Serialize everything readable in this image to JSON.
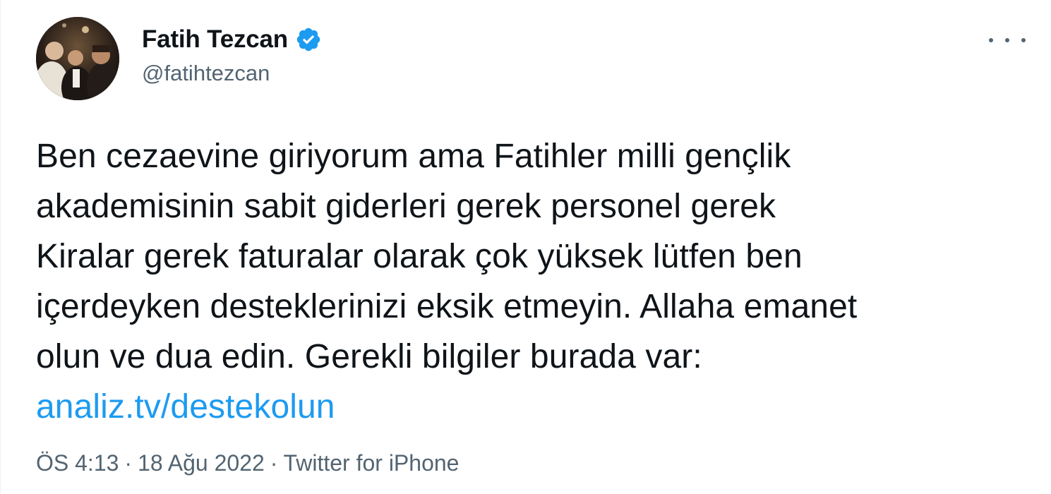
{
  "author": {
    "display_name": "Fatih Tezcan",
    "handle": "@fatihtezcan",
    "verified": true,
    "avatar_icon": "profile-photo"
  },
  "tweet": {
    "lines": [
      "Ben cezaevine giriyorum ama Fatihler milli gençlik",
      "akademisinin sabit giderleri gerek personel gerek",
      "Kiralar gerek faturalar olarak çok yüksek lütfen ben",
      "içerdeyken desteklerinizi eksik etmeyin. Allaha emanet",
      "olun ve dua edin. Gerekli bilgiler burada var:"
    ],
    "link": "analiz.tv/destekolun"
  },
  "meta": {
    "time": "ÖS 4:13",
    "separator": "·",
    "date": "18 Ağu 2022",
    "source": "Twitter for iPhone"
  },
  "colors": {
    "text": "#0f1419",
    "secondary": "#536471",
    "link": "#1d9bf0",
    "verified_badge": "#1d9bf0"
  },
  "icons": {
    "more": "more-horizontal-icon",
    "verified": "verified-badge-icon"
  }
}
